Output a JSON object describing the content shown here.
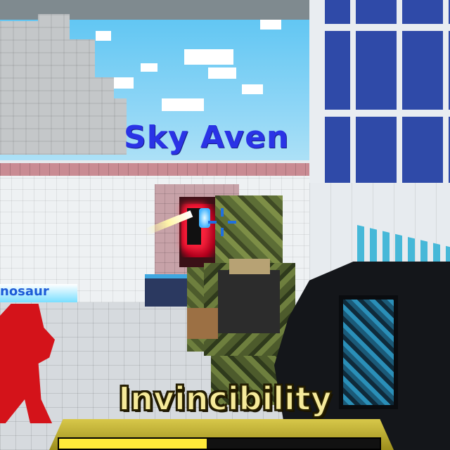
{
  "hud": {
    "powerup_label": "Invincibility",
    "powerup_progress_fraction": 0.46
  },
  "player_tags": {
    "center": "Sky Aven",
    "left": "nosaur"
  },
  "colors": {
    "powerup_text": "#f6ea9a",
    "tag_center": "#2a33e6",
    "tag_left": "#1d5bd6",
    "progress_fill": "#ffea3a",
    "crosshair": "#1f6fe0"
  },
  "icons": {
    "crosshair": "crosshair-icon"
  }
}
